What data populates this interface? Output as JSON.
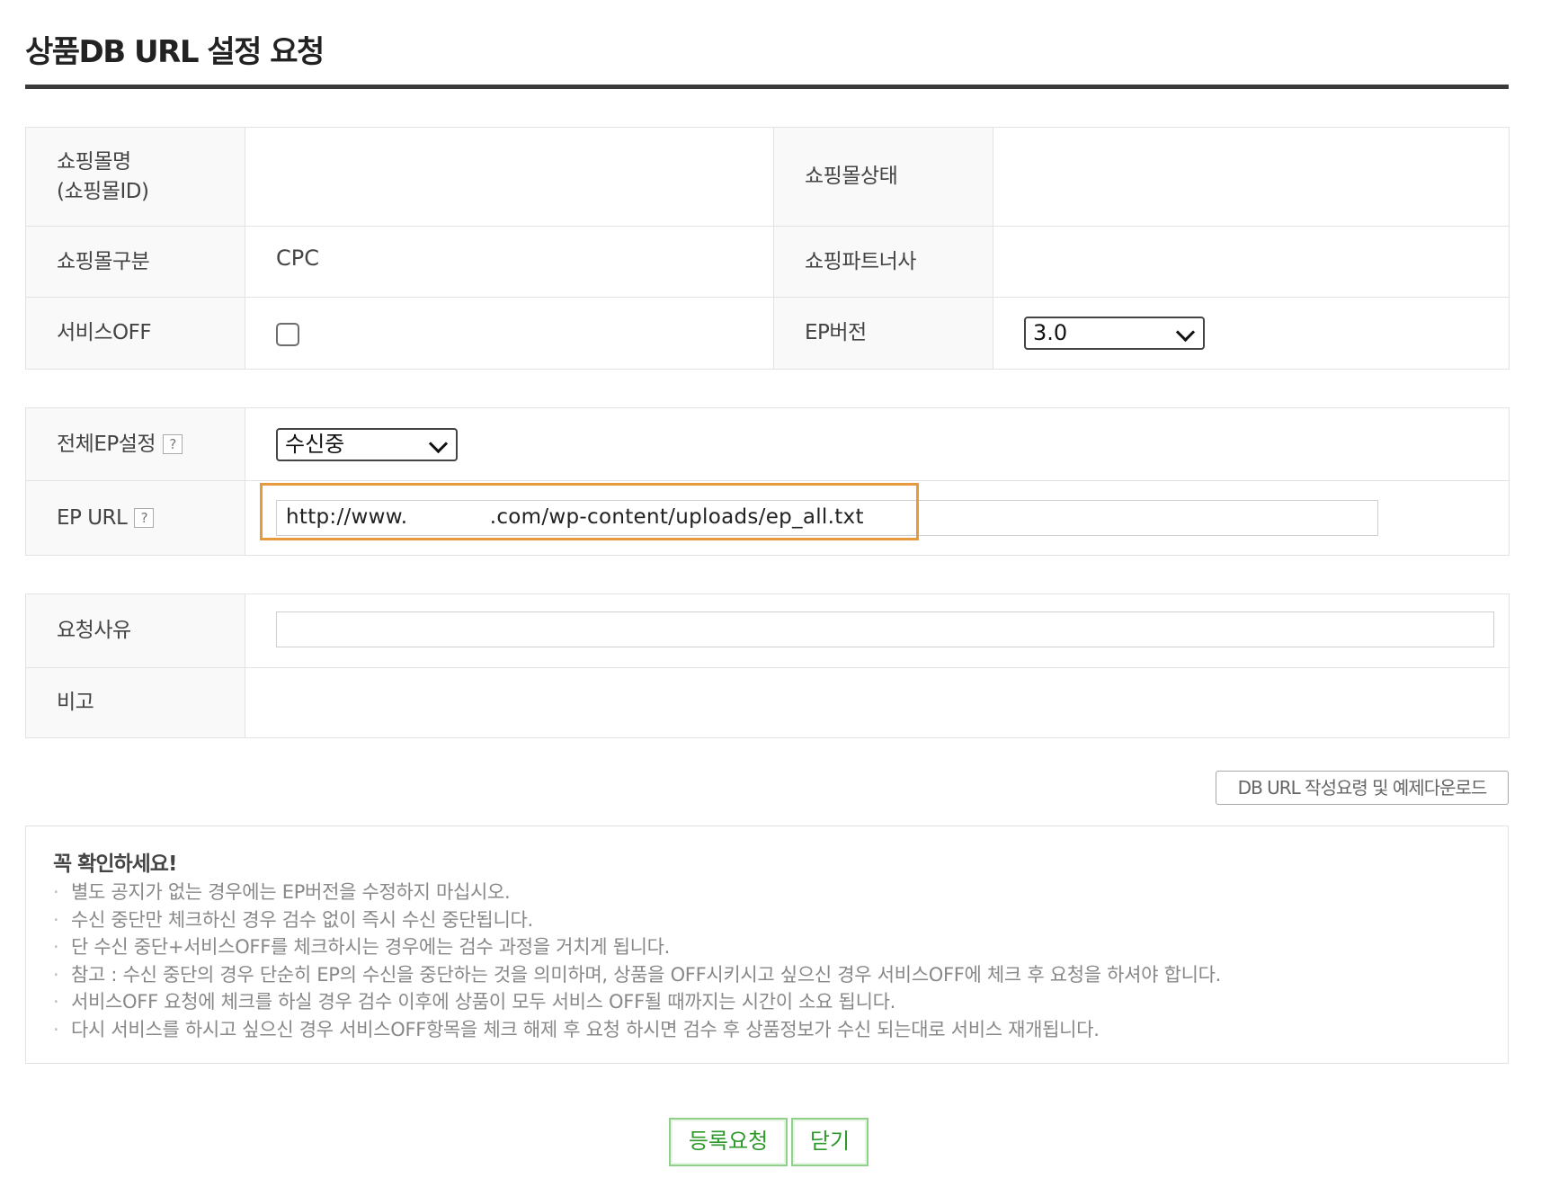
{
  "page": {
    "title": "상품DB URL 설정 요청"
  },
  "info_table": {
    "mall_name_label_line1": "쇼핑몰명",
    "mall_name_label_line2": "(쇼핑몰ID)",
    "mall_name_value": "",
    "mall_status_label": "쇼핑몰상태",
    "mall_status_value": "",
    "mall_type_label": "쇼핑몰구분",
    "mall_type_value": "CPC",
    "partner_label": "쇼핑파트너사",
    "partner_value": "",
    "service_off_label": "서비스OFF",
    "service_off_checked": false,
    "ep_version_label": "EP버전",
    "ep_version_selected": "3.0"
  },
  "ep_table": {
    "all_ep_label": "전체EP설정",
    "all_ep_selected": "수신중",
    "help_icon_glyph": "?",
    "ep_url_label": "EP URL",
    "ep_url_value": "http://www.            .com/wp-content/uploads/ep_all.txt"
  },
  "request_table": {
    "reason_label": "요청사유",
    "reason_value": "",
    "remarks_label": "비고",
    "remarks_value": ""
  },
  "download_button_label": "DB URL 작성요령 및 예제다운로드",
  "notice": {
    "title": "꼭 확인하세요!",
    "bullet": "·",
    "items": [
      "별도 공지가 없는 경우에는 EP버전을 수정하지 마십시오.",
      "수신 중단만 체크하신 경우 검수 없이 즉시 수신 중단됩니다.",
      "단 수신 중단+서비스OFF를 체크하시는 경우에는 검수 과정을 거치게 됩니다.",
      "참고 : 수신 중단의 경우 단순히 EP의 수신을 중단하는 것을 의미하며, 상품을 OFF시키시고 싶으신 경우 서비스OFF에 체크 후 요청을 하셔야 합니다.",
      "서비스OFF 요청에 체크를 하실 경우 검수 이후에 상품이 모두 서비스 OFF될 때까지는 시간이 소요 됩니다.",
      "다시 서비스를 하시고 싶으신 경우 서비스OFF항목을 체크 해제 후 요청 하시면 검수 후 상품정보가 수신 되는대로 서비스 재개됩니다."
    ]
  },
  "buttons": {
    "register_label": "등록요청",
    "close_label": "닫기"
  },
  "colors": {
    "highlight_border": "#e79a3c",
    "button_green": "#2c9a2a",
    "button_border": "#8fd08a",
    "title_rule": "#3a3a3a"
  }
}
